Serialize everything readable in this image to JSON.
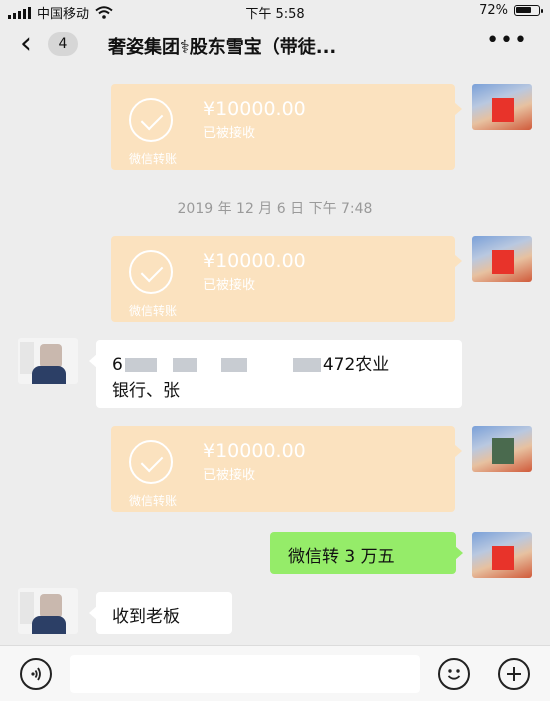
{
  "status_bar": {
    "carrier": "中国移动",
    "time": "下午 5:58",
    "battery": "72%",
    "battery_level": 0.72
  },
  "nav": {
    "back_icon": "chevron-left-icon",
    "unread_count": "4",
    "title": "奢姿集团⚕股东雪宝（带徒...",
    "more_icon": "more-dots-icon"
  },
  "messages": {
    "transfer_1": {
      "amount": "¥10000.00",
      "status": "已被接收",
      "label": "微信转账"
    },
    "timestamp_1": "2019 年 12 月 6 日  下午 7:48",
    "transfer_2": {
      "amount": "¥10000.00",
      "status": "已被接收",
      "label": "微信转账"
    },
    "account_msg": {
      "line1_prefix": "6",
      "line1_suffix": "472农业",
      "line2": "银行、张"
    },
    "transfer_3": {
      "amount": "¥10000.00",
      "status": "已被接收",
      "label": "微信转账"
    },
    "sent_text": "微信转 3 万五",
    "received_text": "收到老板"
  },
  "input_bar": {
    "voice_icon": "voice-icon",
    "emoji_icon": "emoji-icon",
    "plus_icon": "plus-icon"
  },
  "colors": {
    "background": "#ededed",
    "transfer_card": "#fbe2bf",
    "sent_bubble": "#95ec69",
    "received_bubble": "#ffffff"
  }
}
